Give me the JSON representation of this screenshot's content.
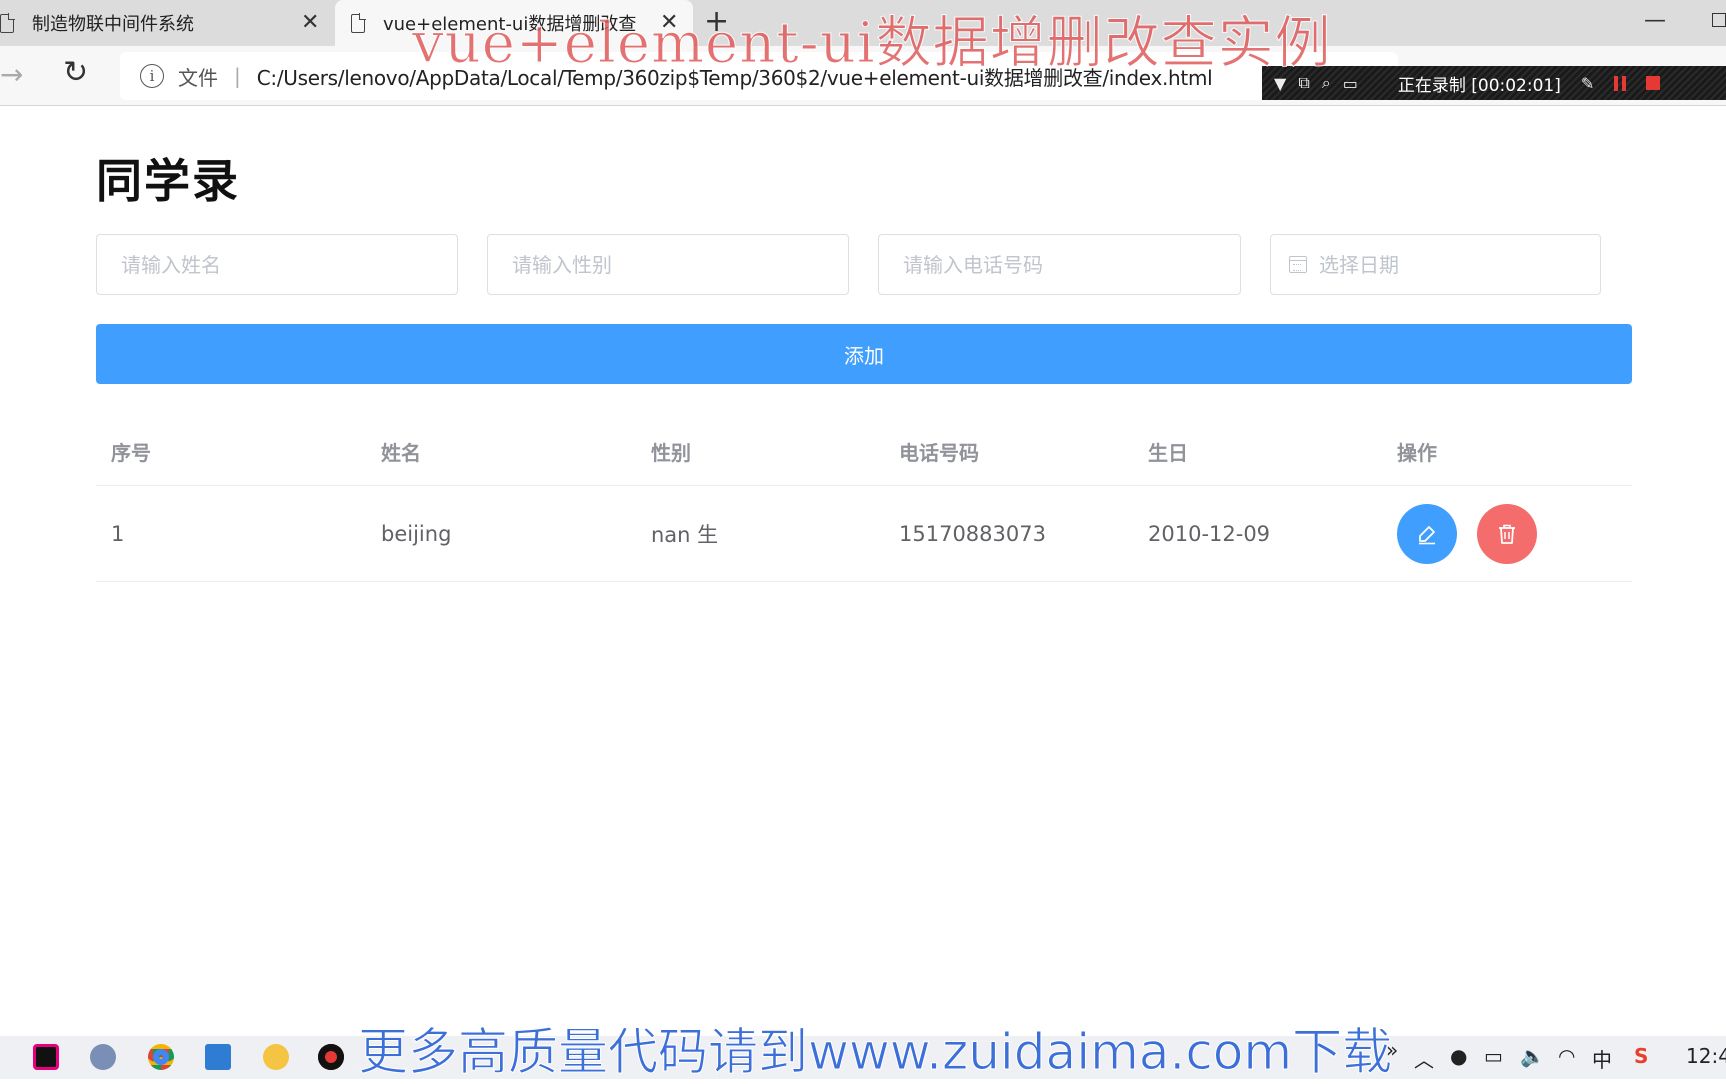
{
  "browser": {
    "tabs": [
      {
        "title": "制造物联中间件系统",
        "close": "✕"
      },
      {
        "title": "vue+element-ui数据增删改查",
        "close": "✕"
      }
    ],
    "new_tab": "+",
    "minimize": "—",
    "forward": "→",
    "reload": "↻",
    "info": "i",
    "file_label": "文件",
    "separator": "|",
    "url": "C:/Users/lenovo/AppData/Local/Temp/360zip$Temp/360$2/vue+element-ui数据增删改查/index.html"
  },
  "recording": {
    "status": "正在录制 [00:02:01]",
    "icons": [
      "dropdown-icon",
      "window-icon",
      "zoom-icon",
      "region-icon",
      "pen-icon",
      "pause-icon",
      "stop-icon"
    ]
  },
  "watermarks": {
    "title": "vue+element-ui数据增删改查实例",
    "bottom": "更多高质量代码请到www.zuidaima.com下载"
  },
  "page": {
    "title": "同学录",
    "form": {
      "name_placeholder": "请输入姓名",
      "gender_placeholder": "请输入性别",
      "phone_placeholder": "请输入电话号码",
      "date_placeholder": "选择日期"
    },
    "add_label": "添加",
    "table": {
      "columns": [
        "序号",
        "姓名",
        "性别",
        "电话号码",
        "生日",
        "操作"
      ],
      "rows": [
        {
          "index": "1",
          "name": "beijing",
          "gender": "nan 生",
          "phone": "15170883073",
          "birthday": "2010-12-09"
        }
      ]
    }
  },
  "taskbar": {
    "chevron": "»",
    "ime": "中",
    "clock": "12:4"
  },
  "colors": {
    "primary": "#409eff",
    "danger": "#f56c6c",
    "header_text": "#909399",
    "body_text": "#606266"
  }
}
